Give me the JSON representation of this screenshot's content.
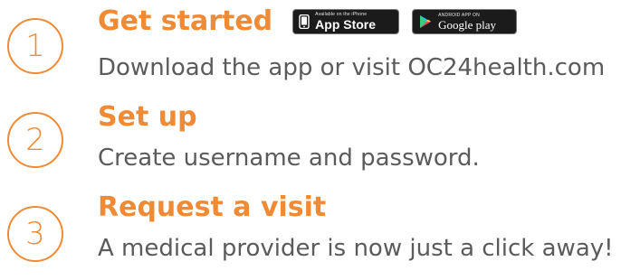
{
  "steps": [
    {
      "number": "1",
      "title": "Get started",
      "description": "Download the app or visit OC24health.com"
    },
    {
      "number": "2",
      "title": "Set up",
      "description": "Create username and password."
    },
    {
      "number": "3",
      "title": "Request a visit",
      "description": "A medical provider is now just a click away!"
    }
  ],
  "badges": {
    "app_store": {
      "small": "Available on the iPhone",
      "big": "App Store",
      "icon": "phone-icon"
    },
    "google_play": {
      "small": "ANDROID APP ON",
      "big": "Google play",
      "icon": "play-triangle-icon"
    }
  },
  "colors": {
    "accent": "#f08a34",
    "text": "#5b5b5b",
    "badge_bg": "#1b1b1b"
  }
}
